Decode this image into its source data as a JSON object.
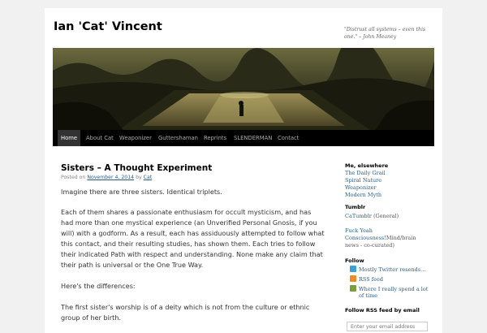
{
  "site": {
    "title": "Ian 'Cat' Vincent",
    "quote": "\"Distrust all systems – even this one.\" – John Meaney"
  },
  "nav": {
    "items": [
      "Home",
      "About Cat",
      "Weaponizer",
      "Guttershaman",
      "Reprints",
      "SLENDERMAN",
      "Contact"
    ]
  },
  "post": {
    "title": "Sisters – A Thought Experiment",
    "meta_posted": "Posted on",
    "meta_date": "November 4, 2014",
    "meta_by": "by",
    "meta_author": "Cat",
    "paragraphs": [
      "Imagine there are three sisters. Identical triplets.",
      "Each of them shares a passionate enthusiasm for occult mysticism, and has had more than one mystical experience (an Unverified Personal Gnosis, if you will) with a godform. As a result, each has assiduously attempted to follow what this contact, and their resulting studies, has shown them. Each tries to follow their indicated Path with respect and understanding. None make any claim that their path is universal or the One True Way.",
      "Here's the differences:",
      "The first sister's worship is of a deity which is not from the culture or ethnic group of her birth."
    ]
  },
  "sidebar": {
    "elsewhere_title": "Me, elsewhere",
    "elsewhere_links": [
      "The Daily Grail",
      "Spiral Nature",
      "Weaponizer",
      "Modern Myth"
    ],
    "tumblr_title": "Tumblr",
    "tumblr_link1": "CaTumblr",
    "tumblr_link1_note": "(General)",
    "tumblr_link2_a": "Fuck Yeah",
    "tumblr_link2_b": "Consciousness!",
    "tumblr_link2_note_a": "Mind/brain",
    "tumblr_link2_note_b": "news - co-curated)",
    "follow_title": "Follow",
    "follow_items": [
      {
        "icon": "twitter-icon",
        "label": "Mostly Twitter resends..."
      },
      {
        "icon": "rss-icon",
        "label": "RSS feed"
      },
      {
        "icon": "comment-icon",
        "label": "Where I really spend a lot",
        "label2": "of time"
      }
    ],
    "rss_email_title": "Follow RSS feed by email",
    "email_placeholder": "Enter your email address"
  },
  "colors": {
    "link": "#2a5d84",
    "nav_bg": "#000000",
    "nav_current": "#333333",
    "page_bg": "#f1f1f1"
  }
}
